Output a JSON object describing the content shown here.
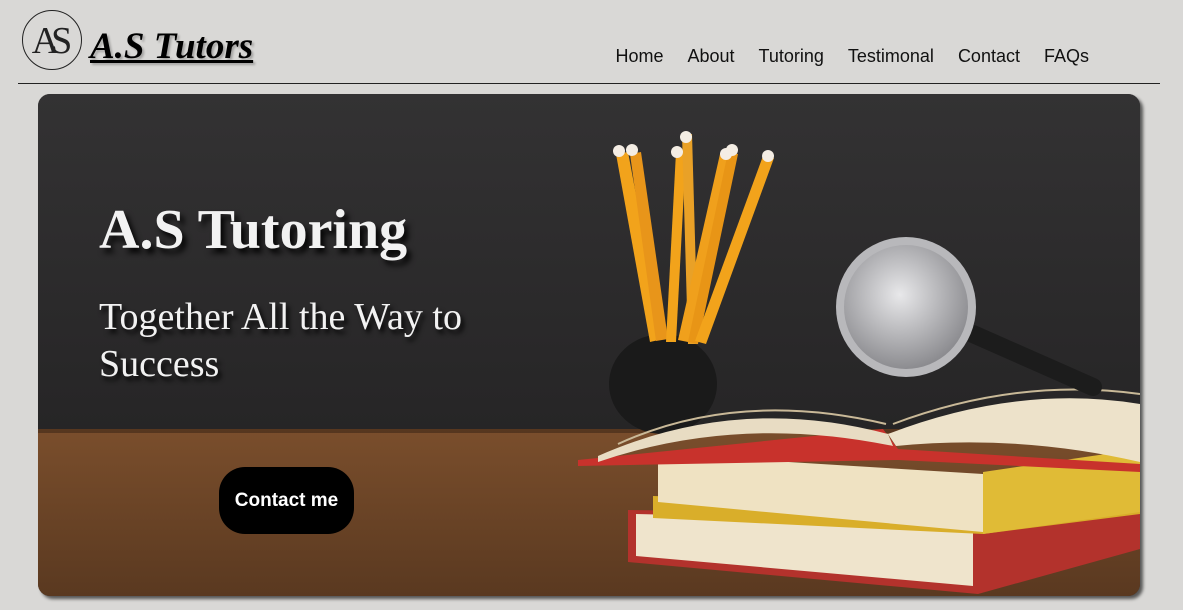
{
  "header": {
    "logo_monogram": "AS",
    "brand": "A.S Tutors",
    "nav": [
      {
        "label": "Home"
      },
      {
        "label": "About"
      },
      {
        "label": "Tutoring"
      },
      {
        "label": "Testimonal"
      },
      {
        "label": "Contact"
      },
      {
        "label": "FAQs"
      }
    ]
  },
  "hero": {
    "title": "A.S Tutoring",
    "subtitle": "Together All the Way to Success",
    "cta_label": "Contact me"
  },
  "colors": {
    "page_bg": "#d9d8d6",
    "chalkboard": "#2e2d2e",
    "desk": "#6b4426",
    "button_bg": "#000000",
    "hero_text": "#f2f2f2"
  }
}
